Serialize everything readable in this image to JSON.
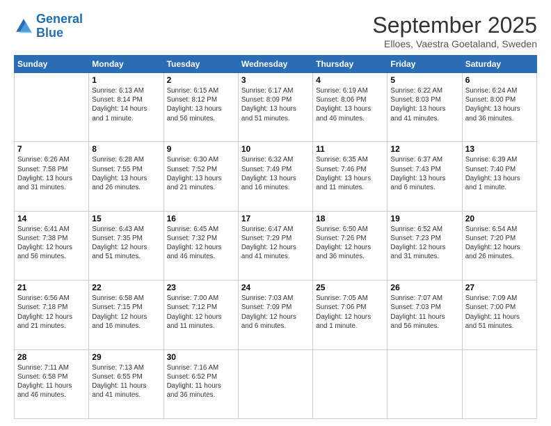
{
  "header": {
    "logo_line1": "General",
    "logo_line2": "Blue",
    "month": "September 2025",
    "location": "Elloes, Vaestra Goetaland, Sweden"
  },
  "days_of_week": [
    "Sunday",
    "Monday",
    "Tuesday",
    "Wednesday",
    "Thursday",
    "Friday",
    "Saturday"
  ],
  "weeks": [
    [
      {
        "day": "",
        "content": ""
      },
      {
        "day": "1",
        "content": "Sunrise: 6:13 AM\nSunset: 8:14 PM\nDaylight: 14 hours\nand 1 minute."
      },
      {
        "day": "2",
        "content": "Sunrise: 6:15 AM\nSunset: 8:12 PM\nDaylight: 13 hours\nand 56 minutes."
      },
      {
        "day": "3",
        "content": "Sunrise: 6:17 AM\nSunset: 8:09 PM\nDaylight: 13 hours\nand 51 minutes."
      },
      {
        "day": "4",
        "content": "Sunrise: 6:19 AM\nSunset: 8:06 PM\nDaylight: 13 hours\nand 46 minutes."
      },
      {
        "day": "5",
        "content": "Sunrise: 6:22 AM\nSunset: 8:03 PM\nDaylight: 13 hours\nand 41 minutes."
      },
      {
        "day": "6",
        "content": "Sunrise: 6:24 AM\nSunset: 8:00 PM\nDaylight: 13 hours\nand 36 minutes."
      }
    ],
    [
      {
        "day": "7",
        "content": "Sunrise: 6:26 AM\nSunset: 7:58 PM\nDaylight: 13 hours\nand 31 minutes."
      },
      {
        "day": "8",
        "content": "Sunrise: 6:28 AM\nSunset: 7:55 PM\nDaylight: 13 hours\nand 26 minutes."
      },
      {
        "day": "9",
        "content": "Sunrise: 6:30 AM\nSunset: 7:52 PM\nDaylight: 13 hours\nand 21 minutes."
      },
      {
        "day": "10",
        "content": "Sunrise: 6:32 AM\nSunset: 7:49 PM\nDaylight: 13 hours\nand 16 minutes."
      },
      {
        "day": "11",
        "content": "Sunrise: 6:35 AM\nSunset: 7:46 PM\nDaylight: 13 hours\nand 11 minutes."
      },
      {
        "day": "12",
        "content": "Sunrise: 6:37 AM\nSunset: 7:43 PM\nDaylight: 13 hours\nand 6 minutes."
      },
      {
        "day": "13",
        "content": "Sunrise: 6:39 AM\nSunset: 7:40 PM\nDaylight: 13 hours\nand 1 minute."
      }
    ],
    [
      {
        "day": "14",
        "content": "Sunrise: 6:41 AM\nSunset: 7:38 PM\nDaylight: 12 hours\nand 56 minutes."
      },
      {
        "day": "15",
        "content": "Sunrise: 6:43 AM\nSunset: 7:35 PM\nDaylight: 12 hours\nand 51 minutes."
      },
      {
        "day": "16",
        "content": "Sunrise: 6:45 AM\nSunset: 7:32 PM\nDaylight: 12 hours\nand 46 minutes."
      },
      {
        "day": "17",
        "content": "Sunrise: 6:47 AM\nSunset: 7:29 PM\nDaylight: 12 hours\nand 41 minutes."
      },
      {
        "day": "18",
        "content": "Sunrise: 6:50 AM\nSunset: 7:26 PM\nDaylight: 12 hours\nand 36 minutes."
      },
      {
        "day": "19",
        "content": "Sunrise: 6:52 AM\nSunset: 7:23 PM\nDaylight: 12 hours\nand 31 minutes."
      },
      {
        "day": "20",
        "content": "Sunrise: 6:54 AM\nSunset: 7:20 PM\nDaylight: 12 hours\nand 26 minutes."
      }
    ],
    [
      {
        "day": "21",
        "content": "Sunrise: 6:56 AM\nSunset: 7:18 PM\nDaylight: 12 hours\nand 21 minutes."
      },
      {
        "day": "22",
        "content": "Sunrise: 6:58 AM\nSunset: 7:15 PM\nDaylight: 12 hours\nand 16 minutes."
      },
      {
        "day": "23",
        "content": "Sunrise: 7:00 AM\nSunset: 7:12 PM\nDaylight: 12 hours\nand 11 minutes."
      },
      {
        "day": "24",
        "content": "Sunrise: 7:03 AM\nSunset: 7:09 PM\nDaylight: 12 hours\nand 6 minutes."
      },
      {
        "day": "25",
        "content": "Sunrise: 7:05 AM\nSunset: 7:06 PM\nDaylight: 12 hours\nand 1 minute."
      },
      {
        "day": "26",
        "content": "Sunrise: 7:07 AM\nSunset: 7:03 PM\nDaylight: 11 hours\nand 56 minutes."
      },
      {
        "day": "27",
        "content": "Sunrise: 7:09 AM\nSunset: 7:00 PM\nDaylight: 11 hours\nand 51 minutes."
      }
    ],
    [
      {
        "day": "28",
        "content": "Sunrise: 7:11 AM\nSunset: 6:58 PM\nDaylight: 11 hours\nand 46 minutes."
      },
      {
        "day": "29",
        "content": "Sunrise: 7:13 AM\nSunset: 6:55 PM\nDaylight: 11 hours\nand 41 minutes."
      },
      {
        "day": "30",
        "content": "Sunrise: 7:16 AM\nSunset: 6:52 PM\nDaylight: 11 hours\nand 36 minutes."
      },
      {
        "day": "",
        "content": ""
      },
      {
        "day": "",
        "content": ""
      },
      {
        "day": "",
        "content": ""
      },
      {
        "day": "",
        "content": ""
      }
    ]
  ]
}
